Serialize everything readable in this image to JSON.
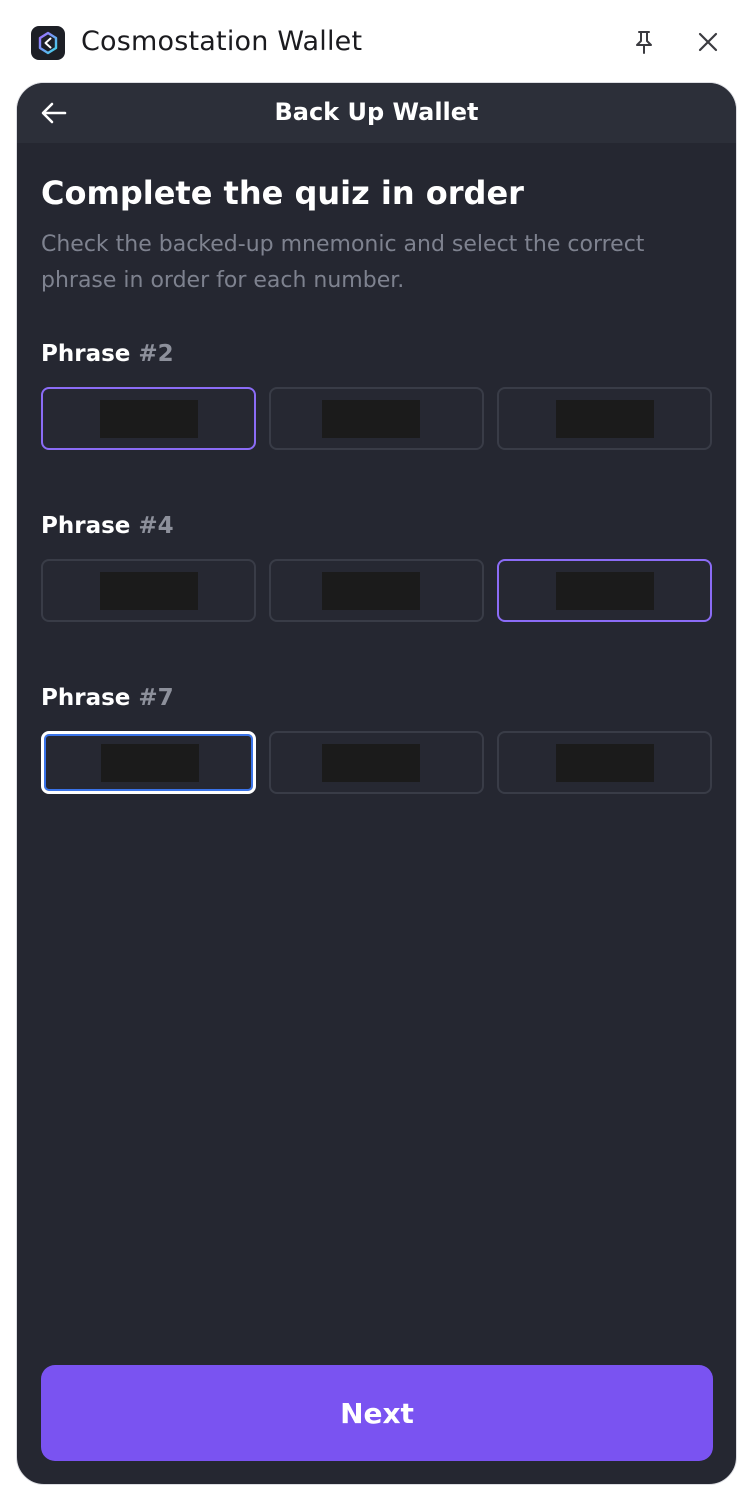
{
  "panel": {
    "app_title": "Cosmostation Wallet",
    "logo_icon": "cosmostation-logo-icon",
    "pin_icon": "pin-icon",
    "close_icon": "close-icon"
  },
  "wallet": {
    "topbar": {
      "back_icon": "arrow-left-icon",
      "title": "Back Up Wallet"
    },
    "heading": "Complete the quiz in order",
    "description": "Check the backed-up mnemonic and select the correct phrase in order for each number.",
    "phrases": [
      {
        "label": "Phrase",
        "number": "#2",
        "options": [
          "",
          "",
          ""
        ],
        "selected_index": 0
      },
      {
        "label": "Phrase",
        "number": "#4",
        "options": [
          "",
          "",
          ""
        ],
        "selected_index": 2
      },
      {
        "label": "Phrase",
        "number": "#7",
        "options": [
          "",
          "",
          ""
        ],
        "focused_index": 0
      }
    ],
    "next_button": "Next",
    "colors": {
      "background": "#252731",
      "accent": "#7a53f1",
      "selected_border": "#8b6cf6",
      "muted_text": "#7e828f"
    }
  }
}
